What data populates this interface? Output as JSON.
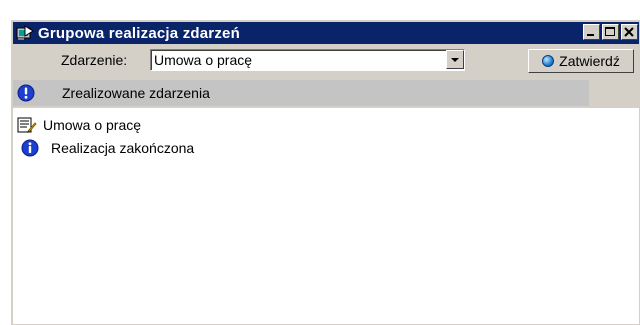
{
  "window": {
    "title": "Grupowa realizacja zdarzeń",
    "controls": [
      "minimize-icon",
      "maximize-icon",
      "close-icon"
    ]
  },
  "toolbar": {
    "event_label": "Zdarzenie:",
    "event_value": "Umowa o pracę",
    "confirm_label": "Zatwierdź"
  },
  "list": {
    "header": "Zrealizowane zdarzenia",
    "items": [
      {
        "label": "Umowa o pracę",
        "icon": "document-edit-icon"
      },
      {
        "label": "Realizacja zakończona",
        "icon": "info-icon"
      }
    ]
  }
}
